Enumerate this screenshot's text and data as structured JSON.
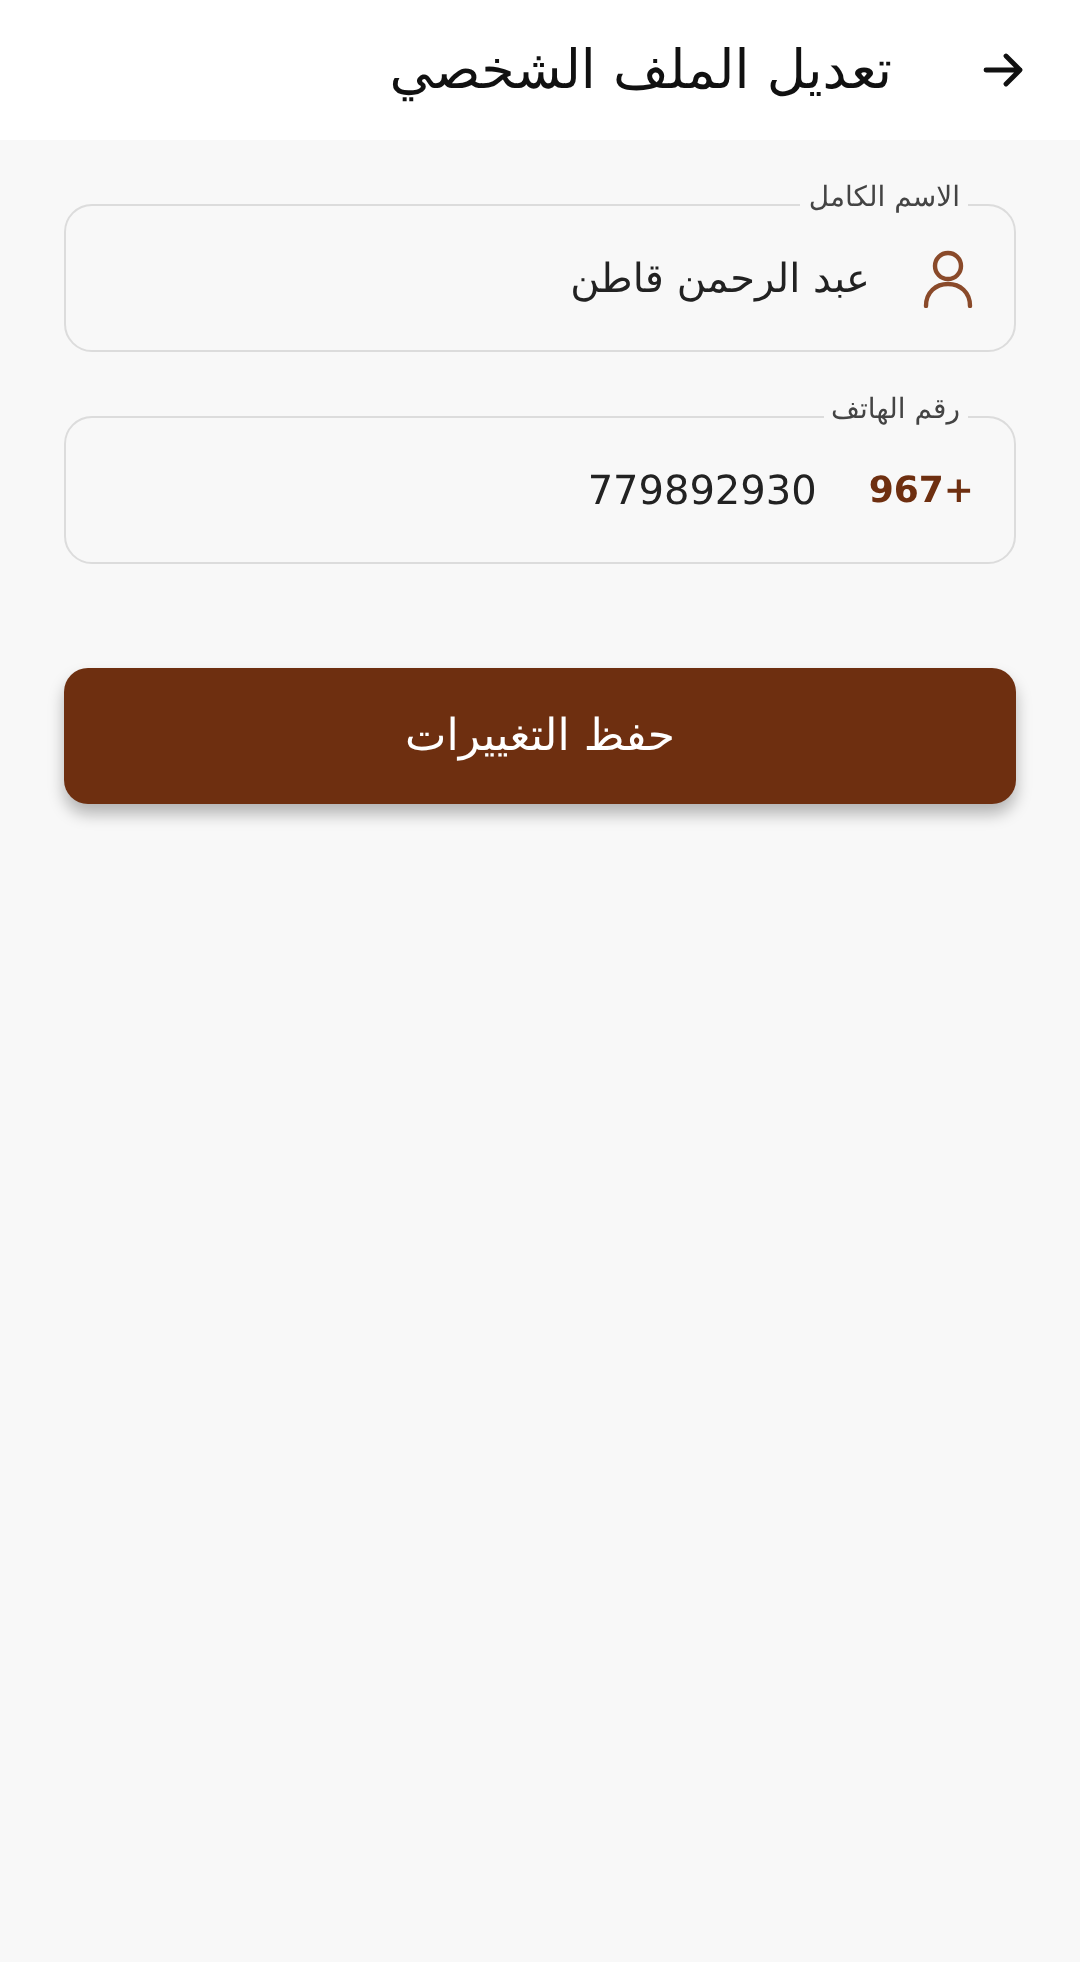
{
  "header": {
    "title": "تعديل الملف الشخصي"
  },
  "fields": [
    {
      "kind": "name",
      "label": "الاسم الكامل",
      "value": "عبد الرحمن قاطن"
    },
    {
      "kind": "phone",
      "label": "رقم الهاتف",
      "prefix": "967+",
      "value": "779892930"
    }
  ],
  "save_button": {
    "label": "حفظ التغييرات"
  }
}
